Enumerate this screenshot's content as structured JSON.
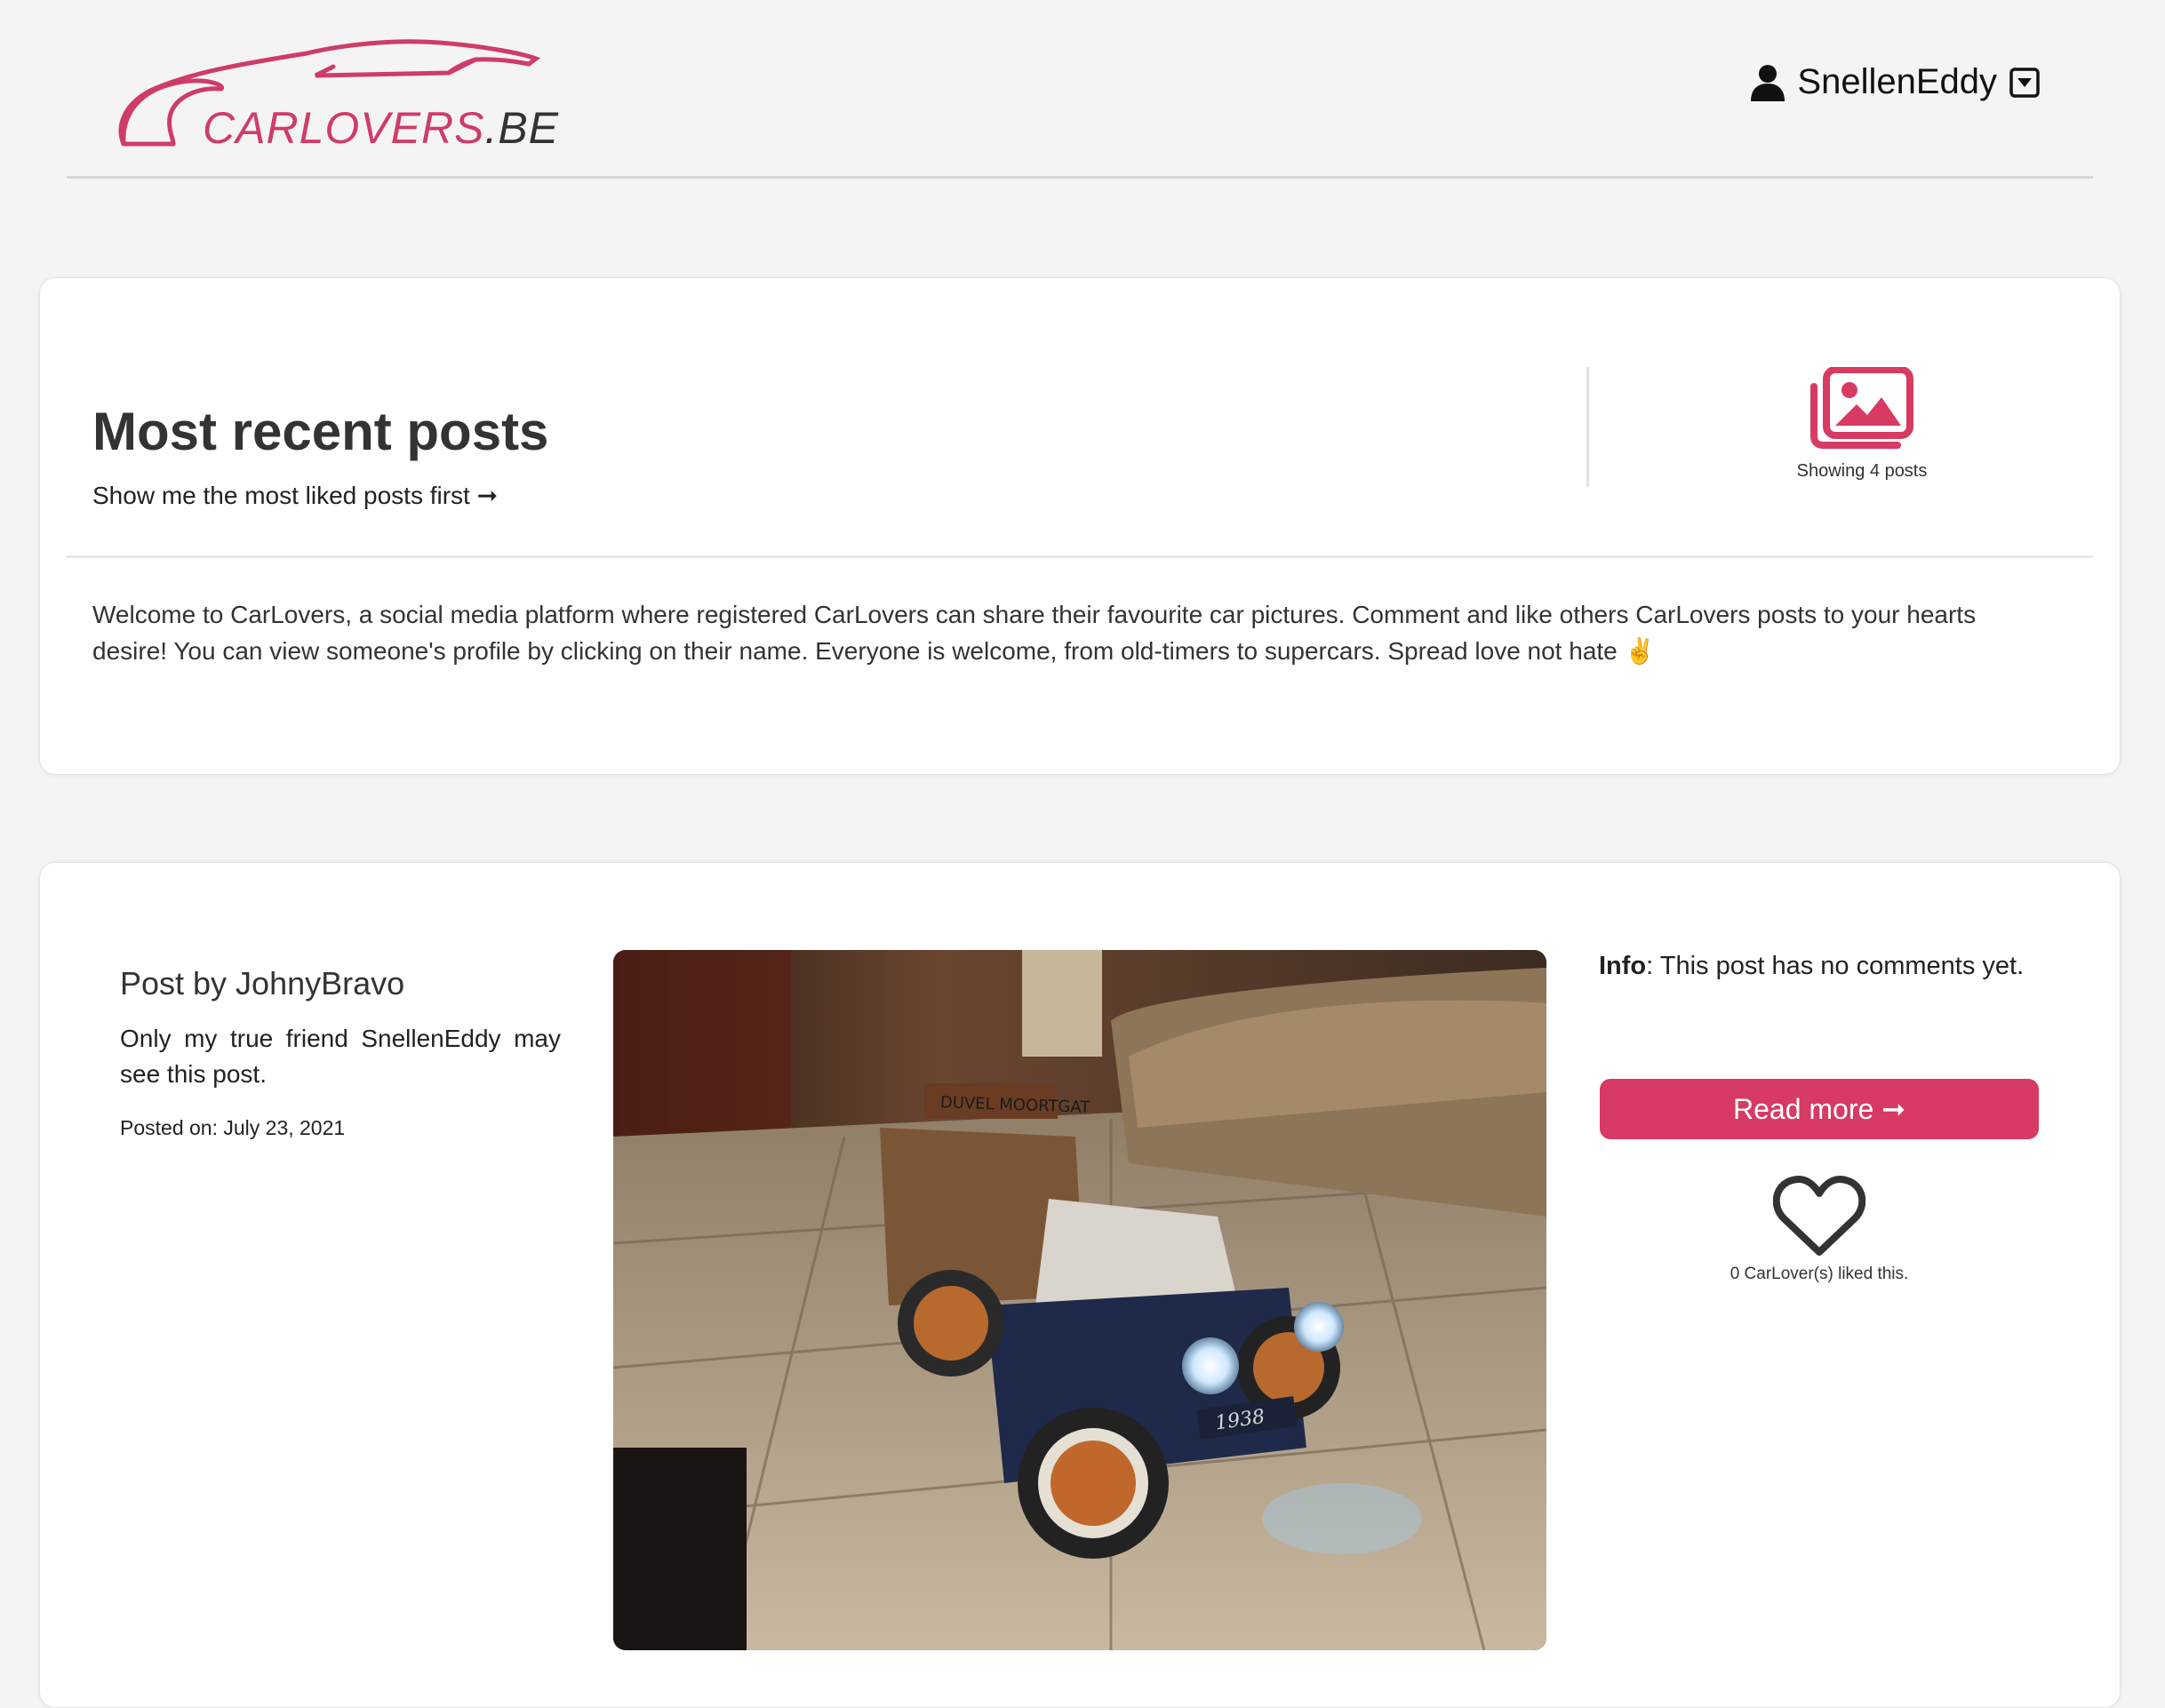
{
  "brand": {
    "logo_text": "CARLOVERS",
    "logo_suffix": ".BE",
    "accent_color": "#d73a63"
  },
  "user": {
    "name": "SnellenEddy",
    "icon": "user-icon",
    "dropdown_icon": "caret-down-square-icon"
  },
  "intro": {
    "title": "Most recent posts",
    "sort_link": "Show me the most liked posts first ➞",
    "count_icon": "images-icon",
    "count_text": "Showing 4 posts",
    "welcome": "Welcome to CarLovers, a social media platform where registered CarLovers can share their favourite car pictures. Comment and like others CarLovers posts to your hearts desire! You can view someone's profile by clicking on their name. Everyone is welcome, from old-timers to supercars. Spread love not hate ✌️"
  },
  "post": {
    "author_heading": "Post by JohnyBravo",
    "description": "Only my true friend SnellenEddy may see this post.",
    "date": "Posted on: July 23, 2021",
    "image_sign_text": "DUVEL MOORTGAT",
    "image_plate_text": "1938",
    "info_label": "Info",
    "info_text": ": This post has no comments yet.",
    "read_more": "Read more ➞",
    "like_icon": "heart-outline-icon",
    "like_text": "0 CarLover(s) liked this."
  }
}
